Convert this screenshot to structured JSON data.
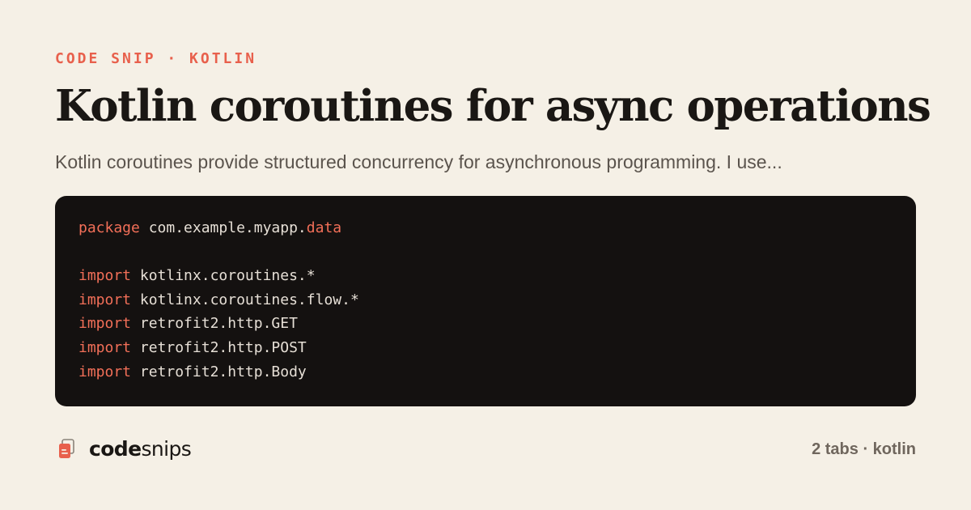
{
  "eyebrow": "CODE SNIP · KOTLIN",
  "title": "Kotlin coroutines for async operations",
  "description": "Kotlin coroutines provide structured concurrency for asynchronous programming. I use...",
  "code": {
    "lines": [
      {
        "keyword": "package",
        "text": " com.example.myapp.",
        "keyword2": "data"
      },
      {
        "keyword": "",
        "text": "",
        "keyword2": ""
      },
      {
        "keyword": "import",
        "text": " kotlinx.coroutines.*",
        "keyword2": ""
      },
      {
        "keyword": "import",
        "text": " kotlinx.coroutines.flow.*",
        "keyword2": ""
      },
      {
        "keyword": "import",
        "text": " retrofit2.http.GET",
        "keyword2": ""
      },
      {
        "keyword": "import",
        "text": " retrofit2.http.POST",
        "keyword2": ""
      },
      {
        "keyword": "import",
        "text": " retrofit2.http.Body",
        "keyword2": ""
      }
    ]
  },
  "brand": {
    "name_bold": "code",
    "name_light": "snips",
    "icon": "snippet-icon"
  },
  "meta": "2 tabs · kotlin",
  "colors": {
    "background": "#f5f0e6",
    "accent": "#e8604c",
    "code_background": "#141110",
    "keyword": "#f26f58"
  }
}
